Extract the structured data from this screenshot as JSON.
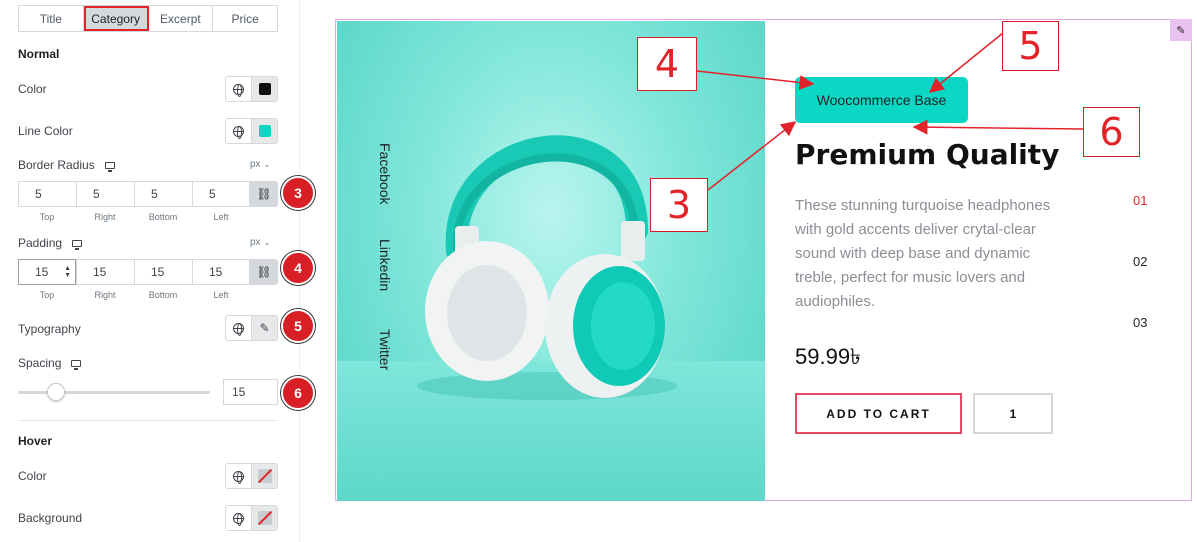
{
  "panel": {
    "tabs": [
      "Title",
      "Category",
      "Excerpt",
      "Price"
    ],
    "active_tab": "Category",
    "normal_heading": "Normal",
    "color_label": "Color",
    "color_value": "#111111",
    "line_color_label": "Line Color",
    "line_color_value": "#0ad8c4",
    "border_radius_label": "Border Radius",
    "unit": "px",
    "border_radius": {
      "top": "5",
      "right": "5",
      "bottom": "5",
      "left": "5"
    },
    "dim_labels": [
      "Top",
      "Right",
      "Bottom",
      "Left"
    ],
    "padding_label": "Padding",
    "padding": {
      "top": "15",
      "right": "15",
      "bottom": "15",
      "left": "15"
    },
    "typography_label": "Typography",
    "spacing_label": "Spacing",
    "spacing_value": "15",
    "spacing_level": 0.15,
    "hover_heading": "Hover",
    "hover_color_label": "Color",
    "hover_background_label": "Background"
  },
  "badges": [
    "3",
    "4",
    "5",
    "6"
  ],
  "preview": {
    "social": [
      "Facebook",
      "Linkedin",
      "Twitter"
    ],
    "category": "Woocommerce Base",
    "title": "Premium Quality",
    "description": "These stunning turquoise headphones with gold accents deliver crytal-clear sound with deep base and dynamic treble, perfect for music lovers and audiophiles.",
    "slides": [
      "01",
      "02",
      "03"
    ],
    "active_slide": "01",
    "price": "59.99৳",
    "add_to_cart": "ADD TO CART",
    "quantity": "1"
  },
  "callouts": [
    "4",
    "5",
    "6",
    "3"
  ],
  "colors": {
    "accent": "#0ad8c4",
    "annotation": "#e2232a"
  }
}
